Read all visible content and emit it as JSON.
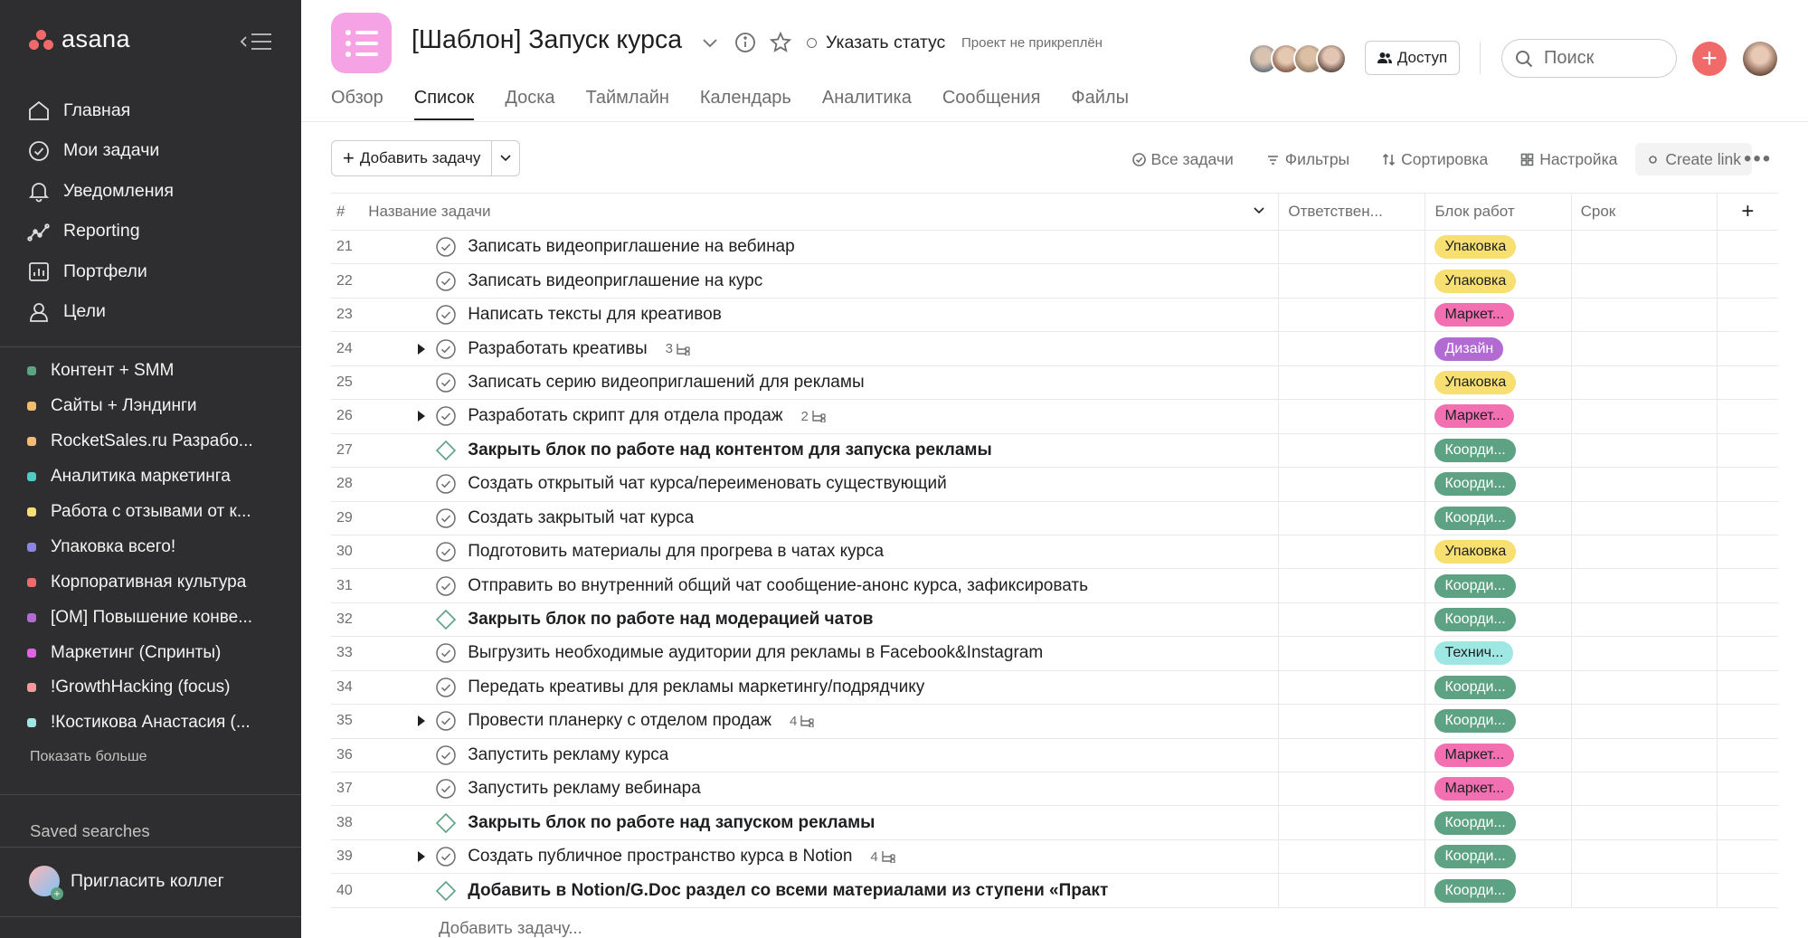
{
  "sidebar": {
    "logo": "asana",
    "nav": [
      {
        "label": "Главная",
        "icon": "home-icon"
      },
      {
        "label": "Мои задачи",
        "icon": "check-circle-icon"
      },
      {
        "label": "Уведомления",
        "icon": "bell-icon"
      },
      {
        "label": "Reporting",
        "icon": "chart-line-icon"
      },
      {
        "label": "Портфели",
        "icon": "portfolio-icon"
      },
      {
        "label": "Цели",
        "icon": "person-icon"
      }
    ],
    "projects": [
      {
        "label": "Контент + SMM",
        "color": "#5da283"
      },
      {
        "label": "Сайты + Лэндинги",
        "color": "#f1bd6c"
      },
      {
        "label": "RocketSales.ru Разрабо...",
        "color": "#f1bd6c"
      },
      {
        "label": "Аналитика маркетинга",
        "color": "#4ecbc4"
      },
      {
        "label": "Работа с отзывами от к...",
        "color": "#f8df72"
      },
      {
        "label": "Упаковка всего!",
        "color": "#8d84e8"
      },
      {
        "label": "Корпоративная культура",
        "color": "#f06a6a"
      },
      {
        "label": "[OM] Повышение конве...",
        "color": "#b36bd4"
      },
      {
        "label": "Маркетинг (Спринты)",
        "color": "#e362e3"
      },
      {
        "label": "!GrowthHacking (focus)",
        "color": "#fc979a"
      },
      {
        "label": "!Костикова Анастасия (...",
        "color": "#9ee7e3"
      }
    ],
    "show_more": "Показать больше",
    "saved_searches": "Saved searches",
    "invite": "Пригласить коллег"
  },
  "header": {
    "title": "[Шаблон] Запуск курса",
    "status": "Указать статус",
    "pinned": "Проект не прикреплён",
    "share": "Доступ",
    "search_placeholder": "Поиск"
  },
  "tabs": [
    "Обзор",
    "Список",
    "Доска",
    "Таймлайн",
    "Календарь",
    "Аналитика",
    "Сообщения",
    "Файлы"
  ],
  "active_tab": "Список",
  "toolbar": {
    "add_task": "Добавить задачу",
    "all_tasks": "Все задачи",
    "filters": "Фильтры",
    "sort": "Сортировка",
    "settings": "Настройка",
    "create_link": "Create link"
  },
  "columns": {
    "num": "#",
    "name": "Название задачи",
    "assignee": "Ответствен...",
    "block": "Блок работ",
    "due": "Срок"
  },
  "tag_colors": {
    "Упаковка": {
      "bg": "#f8df72",
      "fg": "#1e1f21"
    },
    "Маркет...": {
      "bg": "#f26fb2",
      "fg": "#1e1f21"
    },
    "Дизайн": {
      "bg": "#b36bd4",
      "fg": "#ffffff"
    },
    "Коорди...": {
      "bg": "#5da283",
      "fg": "#ffffff"
    },
    "Технич...": {
      "bg": "#9ee7e3",
      "fg": "#1e1f21"
    }
  },
  "tasks": [
    {
      "num": "21",
      "name": "Записать видеоприглашение на вебинар",
      "block": "Упаковка",
      "milestone": false,
      "subtasks": ""
    },
    {
      "num": "22",
      "name": "Записать видеоприглашение на курс",
      "block": "Упаковка",
      "milestone": false,
      "subtasks": ""
    },
    {
      "num": "23",
      "name": "Написать тексты для креативов",
      "block": "Маркет...",
      "milestone": false,
      "subtasks": ""
    },
    {
      "num": "24",
      "name": "Разработать креативы",
      "block": "Дизайн",
      "milestone": false,
      "subtasks": "3"
    },
    {
      "num": "25",
      "name": "Записать серию видеоприглашений для рекламы",
      "block": "Упаковка",
      "milestone": false,
      "subtasks": ""
    },
    {
      "num": "26",
      "name": "Разработать скрипт для отдела продаж",
      "block": "Маркет...",
      "milestone": false,
      "subtasks": "2"
    },
    {
      "num": "27",
      "name": "Закрыть блок по работе над контентом для запуска рекламы",
      "block": "Коорди...",
      "milestone": true,
      "subtasks": ""
    },
    {
      "num": "28",
      "name": "Создать открытый чат курса/переименовать существующий",
      "block": "Коорди...",
      "milestone": false,
      "subtasks": ""
    },
    {
      "num": "29",
      "name": "Создать закрытый чат курса",
      "block": "Коорди...",
      "milestone": false,
      "subtasks": ""
    },
    {
      "num": "30",
      "name": "Подготовить материалы для прогрева в чатах курса",
      "block": "Упаковка",
      "milestone": false,
      "subtasks": ""
    },
    {
      "num": "31",
      "name": "Отправить во внутренний общий чат сообщение-анонс курса, зафиксировать",
      "block": "Коорди...",
      "milestone": false,
      "subtasks": ""
    },
    {
      "num": "32",
      "name": "Закрыть блок по работе над модерацией чатов",
      "block": "Коорди...",
      "milestone": true,
      "subtasks": ""
    },
    {
      "num": "33",
      "name": "Выгрузить необходимые аудитории для рекламы в Facebook&Instagram",
      "block": "Технич...",
      "milestone": false,
      "subtasks": ""
    },
    {
      "num": "34",
      "name": "Передать креативы для рекламы маркетингу/подрядчику",
      "block": "Коорди...",
      "milestone": false,
      "subtasks": ""
    },
    {
      "num": "35",
      "name": "Провести планерку с отделом продаж",
      "block": "Коорди...",
      "milestone": false,
      "subtasks": "4"
    },
    {
      "num": "36",
      "name": "Запустить рекламу курса",
      "block": "Маркет...",
      "milestone": false,
      "subtasks": ""
    },
    {
      "num": "37",
      "name": "Запустить рекламу вебинара",
      "block": "Маркет...",
      "milestone": false,
      "subtasks": ""
    },
    {
      "num": "38",
      "name": "Закрыть блок по работе над запуском рекламы",
      "block": "Коорди...",
      "milestone": true,
      "subtasks": ""
    },
    {
      "num": "39",
      "name": "Создать публичное пространство курса в Notion",
      "block": "Коорди...",
      "milestone": false,
      "subtasks": "4"
    },
    {
      "num": "40",
      "name": "Добавить в Notion/G.Doc раздел со всеми материалами из ступени «Практ",
      "block": "Коорди...",
      "milestone": true,
      "subtasks": ""
    }
  ],
  "add_task_row": "Добавить задачу...",
  "colors": {
    "sidebar_bg": "#2e2e30",
    "accent": "#f06a6a",
    "project_icon": "#f5a3e5"
  }
}
